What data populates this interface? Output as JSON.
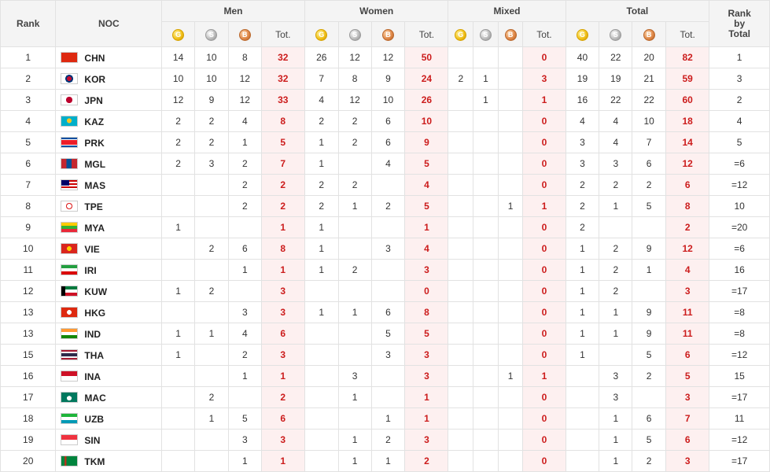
{
  "headers": {
    "rank": "Rank",
    "noc": "NOC",
    "groups": [
      "Men",
      "Women",
      "Mixed",
      "Total"
    ],
    "tot": "Tot.",
    "rank_by_total": "Rank\nby\nTotal",
    "medal_glyphs": {
      "gold": "G",
      "silver": "S",
      "bronze": "B"
    }
  },
  "colors": {
    "total_text": "#cc1c1c",
    "total_bg": "#fdf0f0",
    "header_bg": "#f4f4f4",
    "grid": "#e2e2e2"
  },
  "rows": [
    {
      "rank": "1",
      "code": "CHN",
      "flag": "flag-china-icon",
      "men": [
        "14",
        "10",
        "8",
        "32"
      ],
      "women": [
        "26",
        "12",
        "12",
        "50"
      ],
      "mixed": [
        "",
        "",
        "",
        "0"
      ],
      "total": [
        "40",
        "22",
        "20",
        "82"
      ],
      "rbt": "1"
    },
    {
      "rank": "2",
      "code": "KOR",
      "flag": "flag-south-korea-icon",
      "men": [
        "10",
        "10",
        "12",
        "32"
      ],
      "women": [
        "7",
        "8",
        "9",
        "24"
      ],
      "mixed": [
        "2",
        "1",
        "",
        "3"
      ],
      "total": [
        "19",
        "19",
        "21",
        "59"
      ],
      "rbt": "3"
    },
    {
      "rank": "3",
      "code": "JPN",
      "flag": "flag-japan-icon",
      "men": [
        "12",
        "9",
        "12",
        "33"
      ],
      "women": [
        "4",
        "12",
        "10",
        "26"
      ],
      "mixed": [
        "",
        "1",
        "",
        "1"
      ],
      "total": [
        "16",
        "22",
        "22",
        "60"
      ],
      "rbt": "2"
    },
    {
      "rank": "4",
      "code": "KAZ",
      "flag": "flag-kazakhstan-icon",
      "men": [
        "2",
        "2",
        "4",
        "8"
      ],
      "women": [
        "2",
        "2",
        "6",
        "10"
      ],
      "mixed": [
        "",
        "",
        "",
        "0"
      ],
      "total": [
        "4",
        "4",
        "10",
        "18"
      ],
      "rbt": "4"
    },
    {
      "rank": "5",
      "code": "PRK",
      "flag": "flag-north-korea-icon",
      "men": [
        "2",
        "2",
        "1",
        "5"
      ],
      "women": [
        "1",
        "2",
        "6",
        "9"
      ],
      "mixed": [
        "",
        "",
        "",
        "0"
      ],
      "total": [
        "3",
        "4",
        "7",
        "14"
      ],
      "rbt": "5"
    },
    {
      "rank": "6",
      "code": "MGL",
      "flag": "flag-mongolia-icon",
      "men": [
        "2",
        "3",
        "2",
        "7"
      ],
      "women": [
        "1",
        "",
        "4",
        "5"
      ],
      "mixed": [
        "",
        "",
        "",
        "0"
      ],
      "total": [
        "3",
        "3",
        "6",
        "12"
      ],
      "rbt": "=6"
    },
    {
      "rank": "7",
      "code": "MAS",
      "flag": "flag-malaysia-icon",
      "men": [
        "",
        "",
        "2",
        "2"
      ],
      "women": [
        "2",
        "2",
        "",
        "4"
      ],
      "mixed": [
        "",
        "",
        "",
        "0"
      ],
      "total": [
        "2",
        "2",
        "2",
        "6"
      ],
      "rbt": "=12"
    },
    {
      "rank": "8",
      "code": "TPE",
      "flag": "flag-chinese-taipei-icon",
      "men": [
        "",
        "",
        "2",
        "2"
      ],
      "women": [
        "2",
        "1",
        "2",
        "5"
      ],
      "mixed": [
        "",
        "",
        "1",
        "1"
      ],
      "total": [
        "2",
        "1",
        "5",
        "8"
      ],
      "rbt": "10"
    },
    {
      "rank": "9",
      "code": "MYA",
      "flag": "flag-myanmar-icon",
      "men": [
        "1",
        "",
        "",
        "1"
      ],
      "women": [
        "1",
        "",
        "",
        "1"
      ],
      "mixed": [
        "",
        "",
        "",
        "0"
      ],
      "total": [
        "2",
        "",
        "",
        "2"
      ],
      "rbt": "=20"
    },
    {
      "rank": "10",
      "code": "VIE",
      "flag": "flag-vietnam-icon",
      "men": [
        "",
        "2",
        "6",
        "8"
      ],
      "women": [
        "1",
        "",
        "3",
        "4"
      ],
      "mixed": [
        "",
        "",
        "",
        "0"
      ],
      "total": [
        "1",
        "2",
        "9",
        "12"
      ],
      "rbt": "=6"
    },
    {
      "rank": "11",
      "code": "IRI",
      "flag": "flag-iran-icon",
      "men": [
        "",
        "",
        "1",
        "1"
      ],
      "women": [
        "1",
        "2",
        "",
        "3"
      ],
      "mixed": [
        "",
        "",
        "",
        "0"
      ],
      "total": [
        "1",
        "2",
        "1",
        "4"
      ],
      "rbt": "16"
    },
    {
      "rank": "12",
      "code": "KUW",
      "flag": "flag-kuwait-icon",
      "men": [
        "1",
        "2",
        "",
        "3"
      ],
      "women": [
        "",
        "",
        "",
        "0"
      ],
      "mixed": [
        "",
        "",
        "",
        "0"
      ],
      "total": [
        "1",
        "2",
        "",
        "3"
      ],
      "rbt": "=17"
    },
    {
      "rank": "13",
      "code": "HKG",
      "flag": "flag-hong-kong-icon",
      "men": [
        "",
        "",
        "3",
        "3"
      ],
      "women": [
        "1",
        "1",
        "6",
        "8"
      ],
      "mixed": [
        "",
        "",
        "",
        "0"
      ],
      "total": [
        "1",
        "1",
        "9",
        "11"
      ],
      "rbt": "=8"
    },
    {
      "rank": "13",
      "code": "IND",
      "flag": "flag-india-icon",
      "men": [
        "1",
        "1",
        "4",
        "6"
      ],
      "women": [
        "",
        "",
        "5",
        "5"
      ],
      "mixed": [
        "",
        "",
        "",
        "0"
      ],
      "total": [
        "1",
        "1",
        "9",
        "11"
      ],
      "rbt": "=8"
    },
    {
      "rank": "15",
      "code": "THA",
      "flag": "flag-thailand-icon",
      "men": [
        "1",
        "",
        "2",
        "3"
      ],
      "women": [
        "",
        "",
        "3",
        "3"
      ],
      "mixed": [
        "",
        "",
        "",
        "0"
      ],
      "total": [
        "1",
        "",
        "5",
        "6"
      ],
      "rbt": "=12"
    },
    {
      "rank": "16",
      "code": "INA",
      "flag": "flag-indonesia-icon",
      "men": [
        "",
        "",
        "1",
        "1"
      ],
      "women": [
        "",
        "3",
        "",
        "3"
      ],
      "mixed": [
        "",
        "",
        "1",
        "1"
      ],
      "total": [
        "",
        "3",
        "2",
        "5"
      ],
      "rbt": "15"
    },
    {
      "rank": "17",
      "code": "MAC",
      "flag": "flag-macau-icon",
      "men": [
        "",
        "2",
        "",
        "2"
      ],
      "women": [
        "",
        "1",
        "",
        "1"
      ],
      "mixed": [
        "",
        "",
        "",
        "0"
      ],
      "total": [
        "",
        "3",
        "",
        "3"
      ],
      "rbt": "=17"
    },
    {
      "rank": "18",
      "code": "UZB",
      "flag": "flag-uzbekistan-icon",
      "men": [
        "",
        "1",
        "5",
        "6"
      ],
      "women": [
        "",
        "",
        "1",
        "1"
      ],
      "mixed": [
        "",
        "",
        "",
        "0"
      ],
      "total": [
        "",
        "1",
        "6",
        "7"
      ],
      "rbt": "11"
    },
    {
      "rank": "19",
      "code": "SIN",
      "flag": "flag-singapore-icon",
      "men": [
        "",
        "",
        "3",
        "3"
      ],
      "women": [
        "",
        "1",
        "2",
        "3"
      ],
      "mixed": [
        "",
        "",
        "",
        "0"
      ],
      "total": [
        "",
        "1",
        "5",
        "6"
      ],
      "rbt": "=12"
    },
    {
      "rank": "20",
      "code": "TKM",
      "flag": "flag-turkmenistan-icon",
      "men": [
        "",
        "",
        "1",
        "1"
      ],
      "women": [
        "",
        "1",
        "1",
        "2"
      ],
      "mixed": [
        "",
        "",
        "",
        "0"
      ],
      "total": [
        "",
        "1",
        "2",
        "3"
      ],
      "rbt": "=17"
    }
  ]
}
